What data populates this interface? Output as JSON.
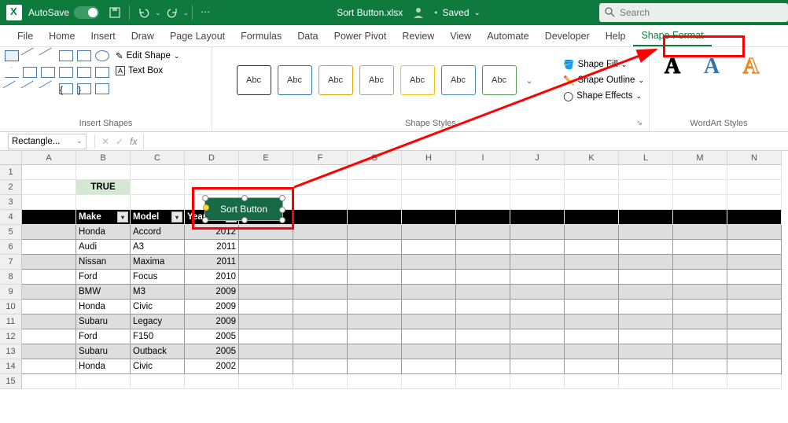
{
  "title": {
    "autosave": "AutoSave",
    "toggle_state": "On",
    "filename": "Sort Button.xlsx",
    "save_state": "Saved",
    "search_placeholder": "Search"
  },
  "tabs": {
    "file": "File",
    "home": "Home",
    "insert": "Insert",
    "draw": "Draw",
    "page_layout": "Page Layout",
    "formulas": "Formulas",
    "data": "Data",
    "power_pivot": "Power Pivot",
    "review": "Review",
    "view": "View",
    "automate": "Automate",
    "developer": "Developer",
    "help": "Help",
    "shape_format": "Shape Format"
  },
  "ribbon": {
    "group_insert_shapes": "Insert Shapes",
    "edit_shape": "Edit Shape",
    "text_box": "Text Box",
    "group_shape_styles": "Shape Styles",
    "style_chip": "Abc",
    "shape_fill": "Shape Fill",
    "shape_outline": "Shape Outline",
    "shape_effects": "Shape Effects",
    "group_wordart": "WordArt Styles",
    "wa_letter": "A"
  },
  "fbar": {
    "namebox": "Rectangle...",
    "fx": "fx"
  },
  "columns": [
    "A",
    "B",
    "C",
    "D",
    "E",
    "F",
    "G",
    "H",
    "I",
    "J",
    "K",
    "L",
    "M",
    "N"
  ],
  "cells": {
    "true_val": "TRUE"
  },
  "table": {
    "headers": [
      "Make",
      "Model",
      "Year"
    ],
    "rows": [
      [
        "Honda",
        "Accord",
        "2012"
      ],
      [
        "Audi",
        "A3",
        "2011"
      ],
      [
        "Nissan",
        "Maxima",
        "2011"
      ],
      [
        "Ford",
        "Focus",
        "2010"
      ],
      [
        "BMW",
        "M3",
        "2009"
      ],
      [
        "Honda",
        "Civic",
        "2009"
      ],
      [
        "Subaru",
        "Legacy",
        "2009"
      ],
      [
        "Ford",
        "F150",
        "2005"
      ],
      [
        "Subaru",
        "Outback",
        "2005"
      ],
      [
        "Honda",
        "Civic",
        "2002"
      ]
    ]
  },
  "shape": {
    "label": "Sort Button"
  }
}
